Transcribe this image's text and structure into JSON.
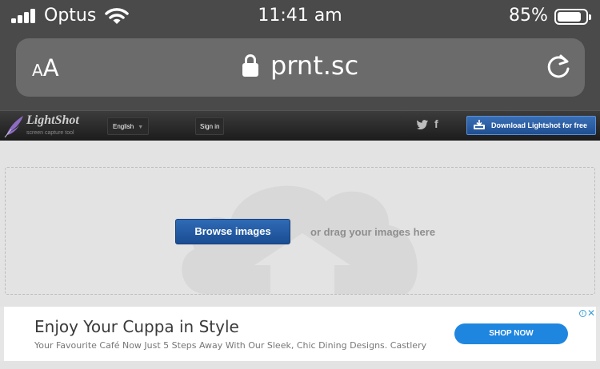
{
  "status_bar": {
    "carrier": "Optus",
    "time": "11:41 am",
    "battery_pct": "85%",
    "battery_level": 0.85,
    "icons": [
      "signal-icon",
      "wifi-icon",
      "battery-icon"
    ]
  },
  "address_bar": {
    "text_size_small": "A",
    "text_size_large": "A",
    "domain": "prnt.sc",
    "icons": [
      "lock-icon",
      "reload-icon"
    ]
  },
  "site_header": {
    "brand": "LightShot",
    "tagline": "screen capture tool",
    "language": "English",
    "signin": "Sign in",
    "social": {
      "facebook_glyph": "f"
    },
    "download_label": "Download Lightshot for free",
    "colors": {
      "download_button": "#2a5fa6"
    }
  },
  "upload": {
    "browse_label": "Browse images",
    "drag_text": "or drag your images here"
  },
  "ad": {
    "info_glyph": "i",
    "close_glyph": "✕",
    "title": "Enjoy Your Cuppa in Style",
    "subtitle": "Your Favourite Café Now Just 5 Steps Away With Our Sleek, Chic Dining Designs. Castlery",
    "cta": "SHOP NOW",
    "colors": {
      "cta": "#1f86e0"
    }
  }
}
